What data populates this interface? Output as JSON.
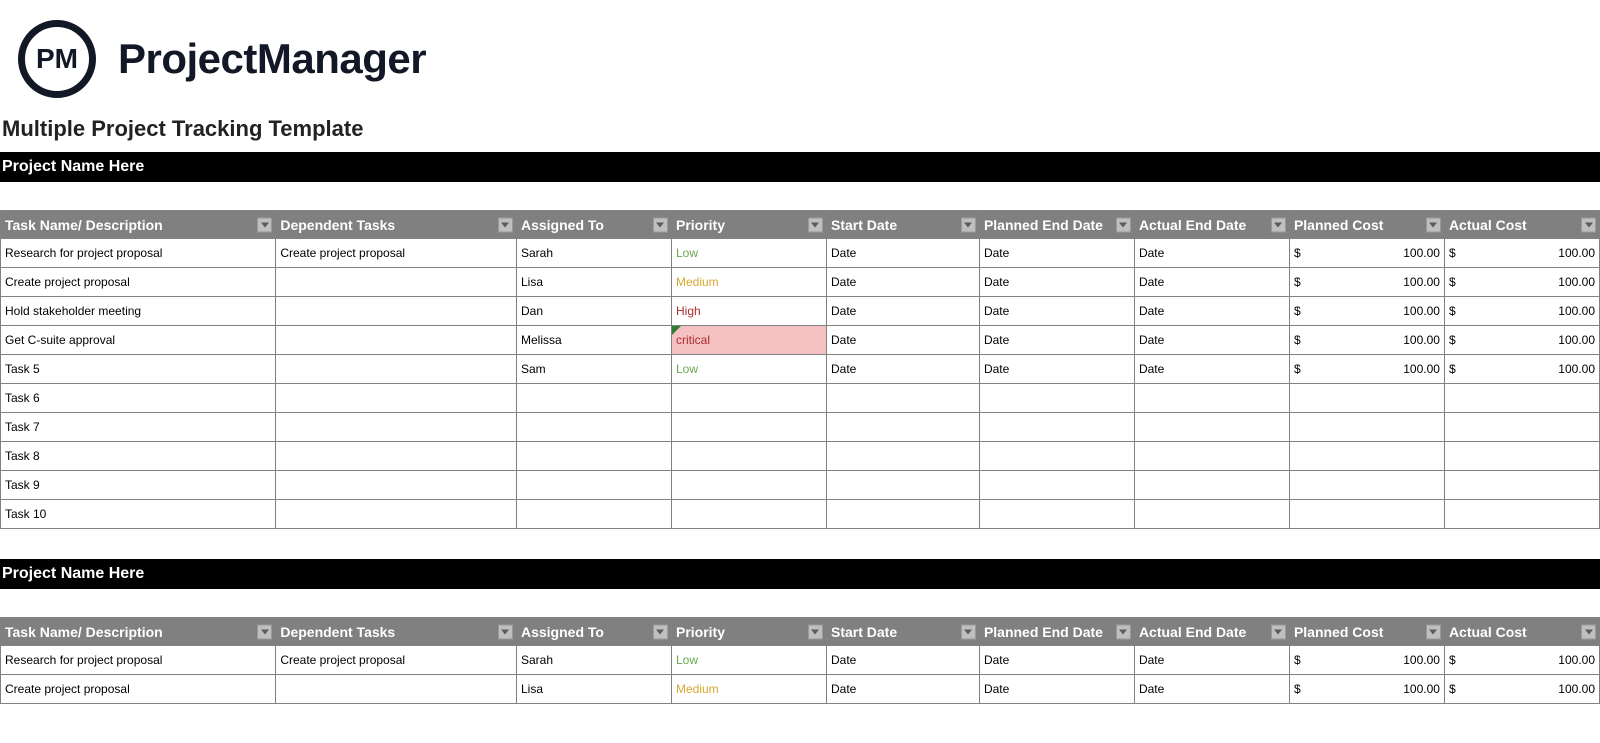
{
  "brand": {
    "logo_text": "PM",
    "name": "ProjectManager"
  },
  "template_title": "Multiple Project Tracking Template",
  "columns": [
    "Task Name/ Description",
    "Dependent Tasks",
    "Assigned To",
    "Priority",
    "Start Date",
    "Planned End Date",
    "Actual End Date",
    "Planned Cost",
    "Actual Cost"
  ],
  "projects": [
    {
      "title": "Project Name Here",
      "rows": [
        {
          "task": "Research for project proposal",
          "dep": "Create project proposal",
          "assignee": "Sarah",
          "priority": "Low",
          "prio_class": "prio-low",
          "start": "Date",
          "plan_end": "Date",
          "act_end": "Date",
          "plan_cost": "100.00",
          "act_cost": "100.00"
        },
        {
          "task": "Create project proposal",
          "dep": "",
          "assignee": "Lisa",
          "priority": "Medium",
          "prio_class": "prio-med",
          "start": "Date",
          "plan_end": "Date",
          "act_end": "Date",
          "plan_cost": "100.00",
          "act_cost": "100.00"
        },
        {
          "task": "Hold stakeholder meeting",
          "dep": "",
          "assignee": "Dan",
          "priority": "High",
          "prio_class": "prio-high",
          "start": "Date",
          "plan_end": "Date",
          "act_end": "Date",
          "plan_cost": "100.00",
          "act_cost": "100.00"
        },
        {
          "task": "Get C-suite approval",
          "dep": "",
          "assignee": "Melissa",
          "priority": "critical",
          "prio_class": "prio-crit",
          "prio_bg": "bg-crit",
          "start": "Date",
          "plan_end": "Date",
          "act_end": "Date",
          "plan_cost": "100.00",
          "act_cost": "100.00"
        },
        {
          "task": "Task 5",
          "dep": "",
          "assignee": "Sam",
          "priority": "Low",
          "prio_class": "prio-low",
          "start": "Date",
          "plan_end": "Date",
          "act_end": "Date",
          "plan_cost": "100.00",
          "act_cost": "100.00"
        },
        {
          "task": "Task 6",
          "dep": "",
          "assignee": "",
          "priority": "",
          "start": "",
          "plan_end": "",
          "act_end": "",
          "plan_cost": "",
          "act_cost": ""
        },
        {
          "task": "Task 7",
          "dep": "",
          "assignee": "",
          "priority": "",
          "start": "",
          "plan_end": "",
          "act_end": "",
          "plan_cost": "",
          "act_cost": ""
        },
        {
          "task": "Task 8",
          "dep": "",
          "assignee": "",
          "priority": "",
          "start": "",
          "plan_end": "",
          "act_end": "",
          "plan_cost": "",
          "act_cost": ""
        },
        {
          "task": "Task 9",
          "dep": "",
          "assignee": "",
          "priority": "",
          "start": "",
          "plan_end": "",
          "act_end": "",
          "plan_cost": "",
          "act_cost": ""
        },
        {
          "task": "Task 10",
          "dep": "",
          "assignee": "",
          "priority": "",
          "start": "",
          "plan_end": "",
          "act_end": "",
          "plan_cost": "",
          "act_cost": ""
        }
      ]
    },
    {
      "title": "Project Name Here",
      "rows": [
        {
          "task": "Research for project proposal",
          "dep": "Create project proposal",
          "assignee": "Sarah",
          "priority": "Low",
          "prio_class": "prio-low",
          "start": "Date",
          "plan_end": "Date",
          "act_end": "Date",
          "plan_cost": "100.00",
          "act_cost": "100.00"
        },
        {
          "task": "Create project proposal",
          "dep": "",
          "assignee": "Lisa",
          "priority": "Medium",
          "prio_class": "prio-med",
          "start": "Date",
          "plan_end": "Date",
          "act_end": "Date",
          "plan_cost": "100.00",
          "act_cost": "100.00"
        }
      ]
    }
  ],
  "currency_symbol": "$"
}
